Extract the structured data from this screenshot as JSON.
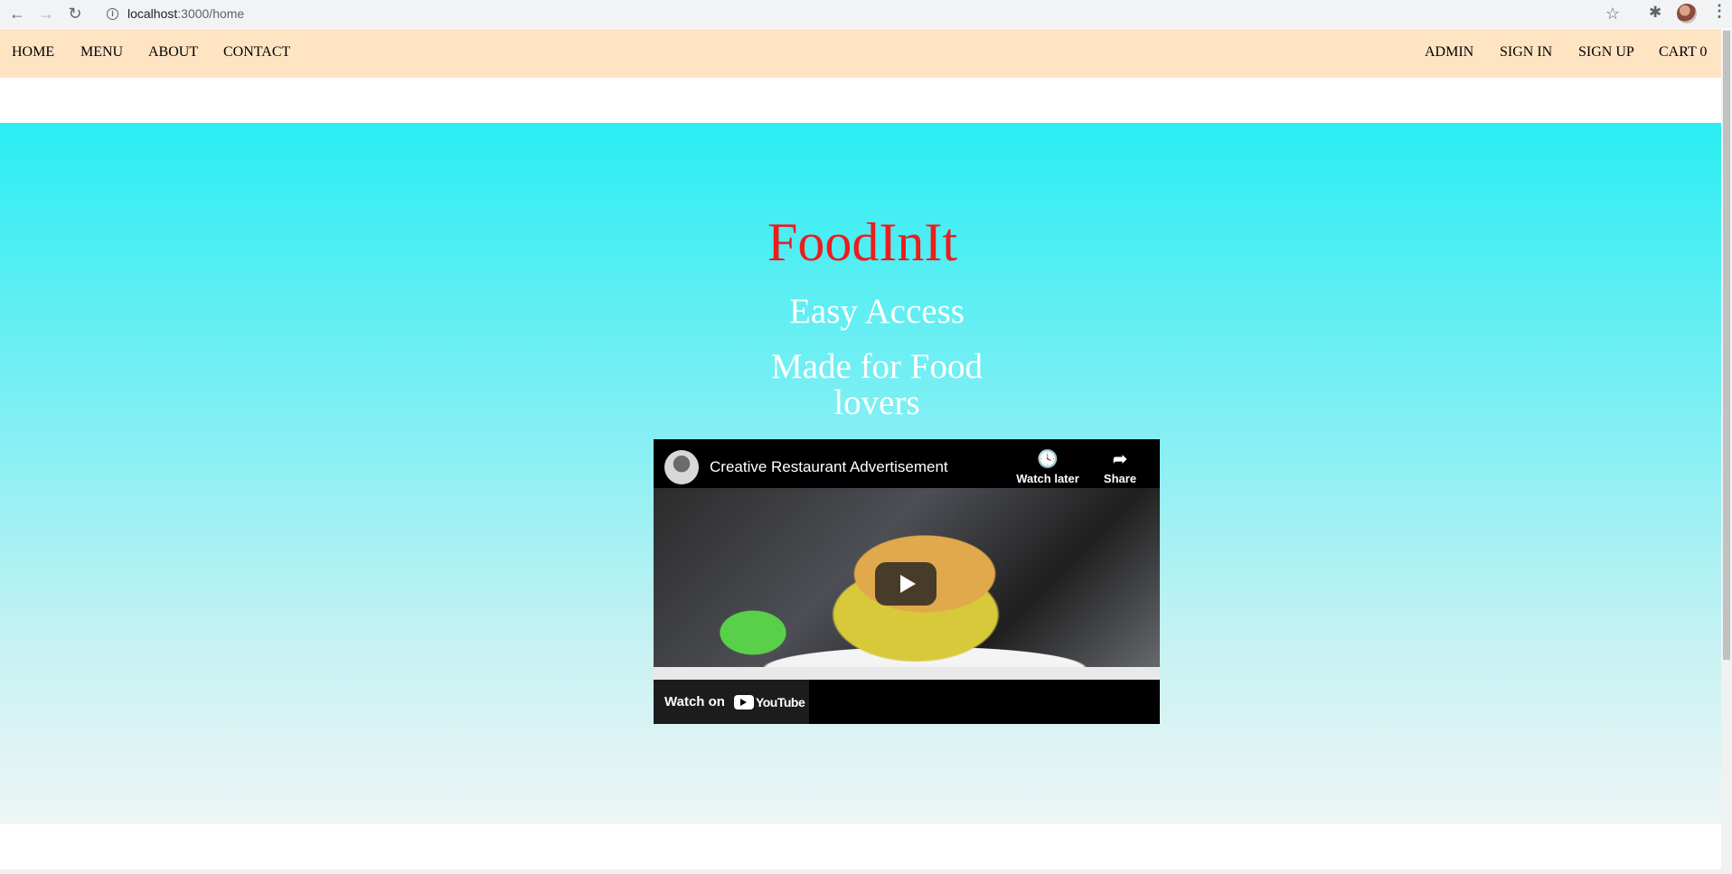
{
  "browser": {
    "url_host": "localhost",
    "url_path": ":3000/home"
  },
  "nav": {
    "left": [
      "HOME",
      "MENU",
      "ABOUT",
      "CONTACT"
    ],
    "right": [
      "ADMIN",
      "SIGN IN",
      "SIGN UP",
      "CART 0"
    ]
  },
  "hero": {
    "title": "FoodInIt",
    "tagline_1": "Easy Access",
    "tagline_2": "Made for Food lovers"
  },
  "video": {
    "title": "Creative Restaurant Advertisement",
    "watch_later_label": "Watch later",
    "share_label": "Share",
    "watch_on_label": "Watch on",
    "youtube_word": "YouTube"
  },
  "colors": {
    "nav_bg": "#ffe4c4",
    "title_color": "#ee1c1c",
    "hero_top": "#29eef3",
    "hero_bottom": "#eef5f5"
  }
}
